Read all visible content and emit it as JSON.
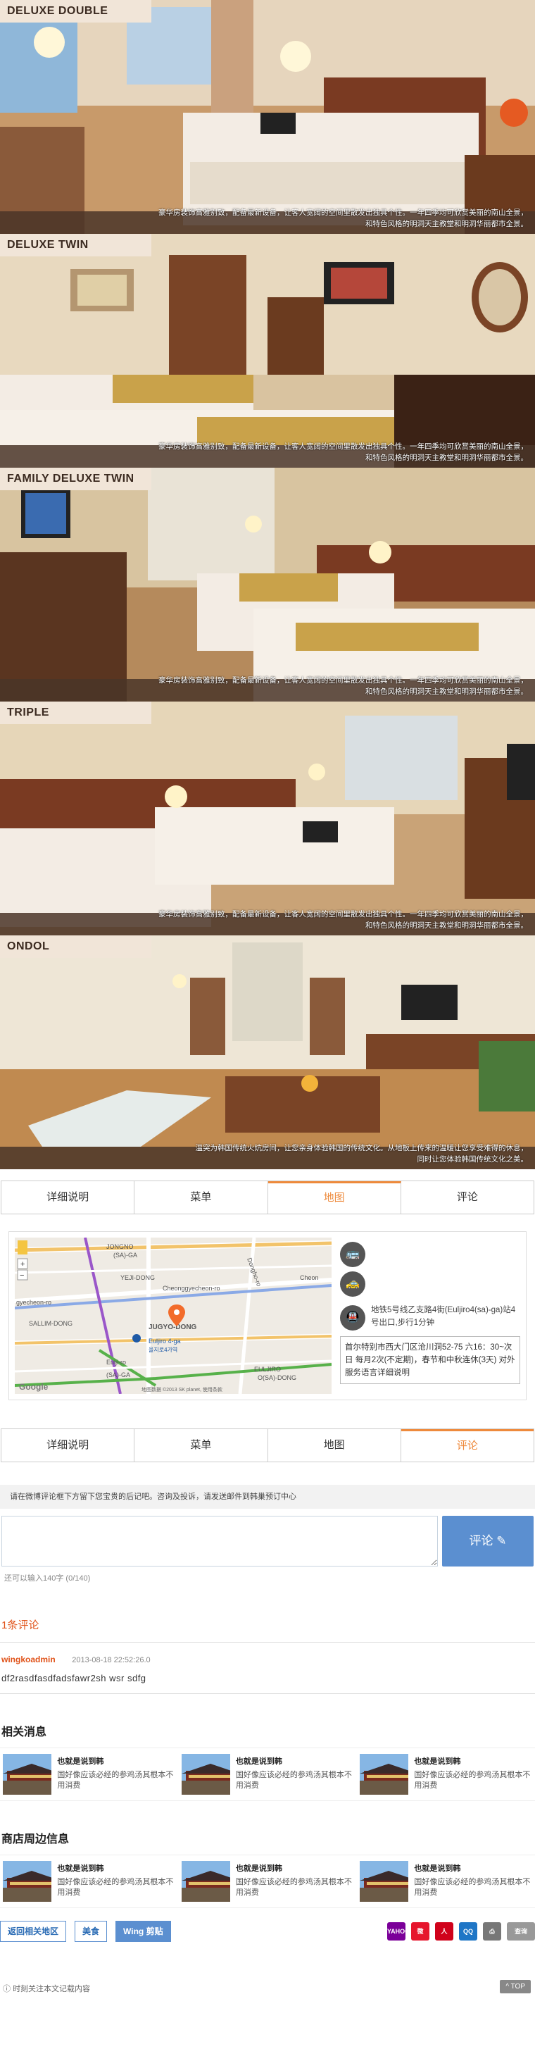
{
  "rooms": [
    {
      "label": "DELUXE DOUBLE",
      "desc1": "豪华房装饰高雅别致，配备最新设备，让客人宽阔的空间里散发出独具个性。一年四季均可欣赏美丽的南山全景，",
      "desc2": "和特色风格的明洞天主教堂和明洞华丽都市全景。"
    },
    {
      "label": "DELUXE TWIN",
      "desc1": "豪华房装饰高雅别致，配备最新设备，让客人宽阔的空间里散发出独具个性。一年四季均可欣赏美丽的南山全景，",
      "desc2": "和特色风格的明洞天主教堂和明洞华丽都市全景。"
    },
    {
      "label": "FAMILY DELUXE TWIN",
      "desc1": "豪华房装饰高雅别致，配备最新设备，让客人宽阔的空间里散发出独具个性。一年四季均可欣赏美丽的南山全景，",
      "desc2": "和特色风格的明洞天主教堂和明洞华丽都市全景。"
    },
    {
      "label": "TRIPLE",
      "desc1": "豪华房装饰高雅别致，配备最新设备，让客人宽阔的空间里散发出独具个性。一年四季均可欣赏美丽的南山全景，",
      "desc2": "和特色风格的明洞天主教堂和明洞华丽都市全景。"
    },
    {
      "label": "ONDOL",
      "desc1": "温突为韩国传统火炕房间，让您亲身体验韩国的传统文化。从地板上传来的温暖让您享受难得的休息，",
      "desc2": "同时让您体验韩国传统文化之美。"
    }
  ],
  "tabs1": [
    "详细说明",
    "菜单",
    "地图",
    "评论"
  ],
  "tabs2": [
    "详细说明",
    "菜单",
    "地图",
    "评论"
  ],
  "map": {
    "labels": {
      "jongno": "JONGNO",
      "sa_ga": "(SA)-GA",
      "yeji": "YEJI-DONG",
      "cheong": "Cheon",
      "gyecheon": "gyecheon-ro",
      "jugyo": "JUGYO-DONG",
      "sallim": "SALLIM-DONG",
      "station": "Euljiro 4-ga",
      "station_kr": "을지로4가역",
      "eulji": "EULJIRO",
      "sa_ga2": "(SA)-GA",
      "sa_ga3": "(SA)-GA",
      "eulji_ro": "Eulji-ro",
      "sa_ga4": "(SA)-GA",
      "o_dong": "O(SA)-DONG",
      "cheonggyecheon": "Cheonggyecheon-ro",
      "yeji_ro": "Dongho-ro"
    },
    "google": "Google",
    "attribution": "地图数据 ©2013 SK planet, 使用条款",
    "zoom_in": "+",
    "zoom_out": "−"
  },
  "transit": {
    "metro_text": "地铁5号线乙支路4街(Euljiro4(sa)-ga)站4号出口,步行1分钟",
    "hours": "首尔特别市西大门区沧川洞52-75 六16：30~次日 每月2次(不定期)，春节和中秋连休(3天) 对外服务语言详细说明",
    "bus_icon": "bus-icon",
    "taxi_icon": "taxi-icon",
    "metro_icon": "subway-icon"
  },
  "comment_section": {
    "notice": "请在微博评论框下方留下您宝贵的后记吧。咨询及投诉，请发送邮件到韩巢预订中心",
    "button": "评论",
    "counter": "还可以输入140字 (0/140)",
    "count_title": "1条评论",
    "comments": [
      {
        "user": "wingkoadmin",
        "time": "2013-08-18 22:52:26.0",
        "text": "df2rasdfasdfadsfawr2sh wsr sdfg"
      }
    ]
  },
  "related": {
    "title": "相关消息",
    "cards": [
      {
        "title": "也就是说到韩",
        "desc": "国好像应该必经的参鸡汤其根本不用消费"
      },
      {
        "title": "也就是说到韩",
        "desc": "国好像应该必经的参鸡汤其根本不用消费"
      },
      {
        "title": "也就是说到韩",
        "desc": "国好像应该必经的参鸡汤其根本不用消费"
      }
    ]
  },
  "nearby": {
    "title": "商店周边信息",
    "cards": [
      {
        "title": "也就是说到韩",
        "desc": "国好像应该必经的参鸡汤其根本不用消费"
      },
      {
        "title": "也就是说到韩",
        "desc": "国好像应该必经的参鸡汤其根本不用消费"
      },
      {
        "title": "也就是说到韩",
        "desc": "国好像应该必经的参鸡汤其根本不用消费"
      }
    ]
  },
  "footer": {
    "btn_back": "返回相关地区",
    "btn_food": "美食",
    "btn_wing": "Wing 剪贴",
    "share": [
      {
        "name": "yahoo-icon",
        "label": "YAHOO",
        "color": "#7b0099"
      },
      {
        "name": "weibo-icon",
        "label": "微",
        "color": "#e6162d"
      },
      {
        "name": "renren-icon",
        "label": "人",
        "color": "#d0021b"
      },
      {
        "name": "qq-icon",
        "label": "QQ",
        "color": "#1f76c6"
      },
      {
        "name": "print-icon",
        "label": "⎙",
        "color": "#777"
      },
      {
        "name": "query-icon",
        "label": "查询",
        "color": "#999"
      }
    ]
  },
  "bottom": {
    "tip": "时刻关注本文记载内容",
    "top": "^ TOP"
  }
}
